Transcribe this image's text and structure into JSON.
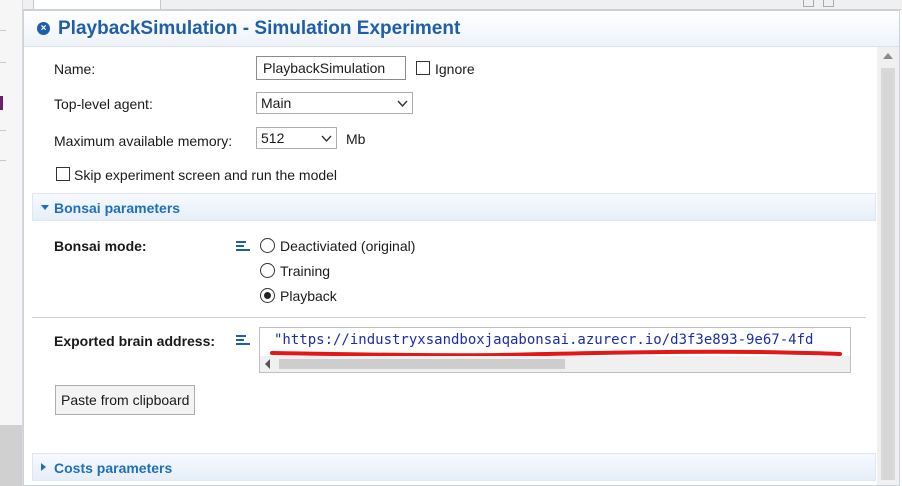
{
  "window": {
    "title": "PlaybackSimulation - Simulation Experiment"
  },
  "general": {
    "name_label": "Name:",
    "name_value": "PlaybackSimulation",
    "ignore_label": "Ignore",
    "ignore_checked": false,
    "top_agent_label": "Top-level agent:",
    "top_agent_value": "Main",
    "memory_label": "Maximum available memory:",
    "memory_value": "512",
    "memory_unit": "Mb",
    "skip_label": "Skip experiment screen and run the model",
    "skip_checked": false
  },
  "bonsai": {
    "section_title": "Bonsai parameters",
    "mode_label": "Bonsai mode:",
    "mode_options": [
      {
        "label": "Deactiviated (original)",
        "selected": false
      },
      {
        "label": "Training",
        "selected": false
      },
      {
        "label": "Playback",
        "selected": true
      }
    ],
    "brain_label": "Exported brain address:",
    "brain_value": "\"https://industryxsandboxjaqabonsai.azurecr.io/d3f3e893-9e67-4fd",
    "paste_button": "Paste from clipboard",
    "annotation_color": "#e01818"
  },
  "costs": {
    "section_title": "Costs parameters"
  },
  "colors": {
    "title_blue": "#1f5ea8",
    "section_blue": "#1f6fb8",
    "code_blue": "#1b2ea8"
  },
  "icons": [
    "close-panel-icon",
    "dynamic-value-icon",
    "chevron-down-icon",
    "expand-arrow-icon",
    "collapse-arrow-icon"
  ]
}
